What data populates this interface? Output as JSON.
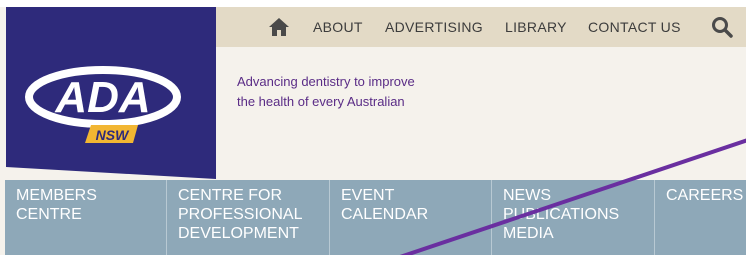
{
  "header": {
    "utility_nav": [
      {
        "label": "ABOUT"
      },
      {
        "label": "ADVERTISING"
      },
      {
        "label": "LIBRARY"
      },
      {
        "label": "CONTACT US"
      }
    ],
    "icons": {
      "home": "home-icon",
      "search": "search-icon"
    }
  },
  "logo": {
    "main_text": "ADA",
    "sub_text": "NSW"
  },
  "tagline": {
    "line1": "Advancing dentistry to improve",
    "line2": "the health of every Australian"
  },
  "main_nav": [
    {
      "lines": [
        "MEMBERS",
        "CENTRE"
      ]
    },
    {
      "lines": [
        "CENTRE FOR",
        "PROFESSIONAL",
        "DEVELOPMENT"
      ]
    },
    {
      "lines": [
        "EVENT",
        "CALENDAR"
      ]
    },
    {
      "lines": [
        "NEWS",
        "PUBLICATIONS",
        "MEDIA"
      ]
    },
    {
      "lines": [
        "CAREERS"
      ]
    }
  ],
  "colors": {
    "logo_bg": "#2e2a7b",
    "logo_accent": "#f2b632",
    "utility_bar": "#e3dac6",
    "nav_bg": "#8ea8b8",
    "tagline": "#5a2c86",
    "slash": "#6a2fa0"
  }
}
